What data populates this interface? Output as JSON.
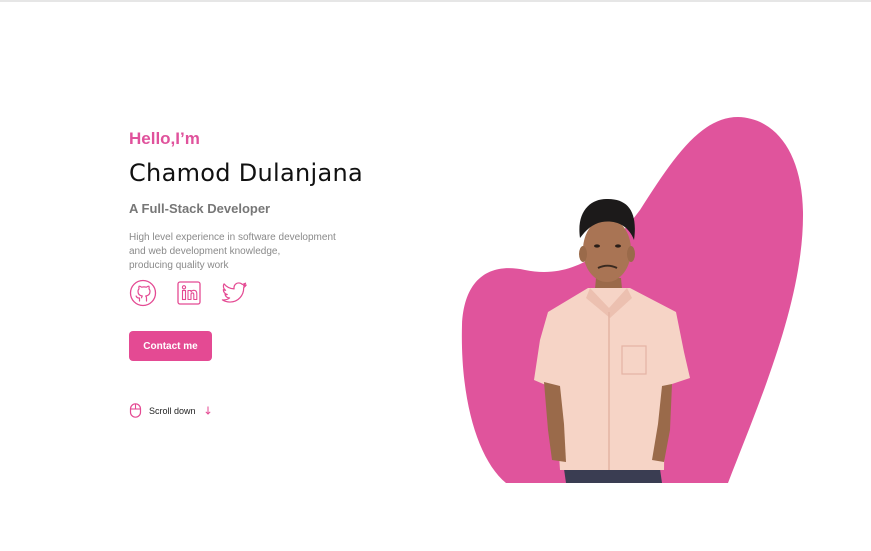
{
  "hero": {
    "greeting": "Hello,I’m",
    "name": "Chamod Dulanjana",
    "role": "A Full-Stack Developer",
    "description_lines": [
      "High level experience in software development",
      "and web development knowledge,",
      "producing quality work"
    ]
  },
  "socials": [
    {
      "icon": "github-icon"
    },
    {
      "icon": "linkedin-icon"
    },
    {
      "icon": "twitter-icon"
    }
  ],
  "contact_button": {
    "label": "Contact me"
  },
  "scroll": {
    "label": "Scroll down",
    "icon": "mouse-icon",
    "arrow_icon": "arrow-down-icon"
  },
  "colors": {
    "accent": "#e44a93",
    "blob": "#e0549c",
    "name_text": "#111111",
    "muted_text": "#8a8a8a"
  }
}
